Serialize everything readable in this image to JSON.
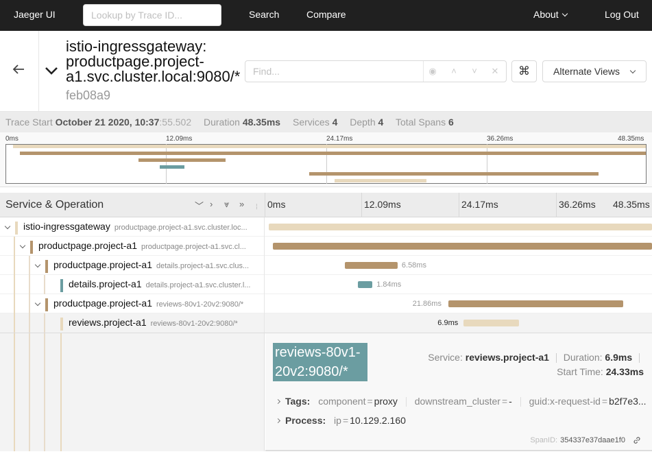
{
  "nav": {
    "brand": "Jaeger UI",
    "lookup_placeholder": "Lookup by Trace ID...",
    "search": "Search",
    "compare": "Compare",
    "about": "About",
    "logout": "Log Out"
  },
  "header": {
    "title": "istio-ingressgateway: productpage.project-a1.svc.cluster.local:9080/*",
    "trace_id": "feb08a9",
    "find_placeholder": "Find...",
    "alternate_views": "Alternate Views",
    "shortcut_glyph": "⌘"
  },
  "summary": {
    "trace_start_label": "Trace Start",
    "trace_start_value": "October 21 2020, 10:37",
    "trace_start_secs": ":55.502",
    "duration_label": "Duration",
    "duration_value": "48.35ms",
    "services_label": "Services",
    "services_value": "4",
    "depth_label": "Depth",
    "depth_value": "4",
    "total_spans_label": "Total Spans",
    "total_spans_value": "6"
  },
  "ticks": [
    "0ms",
    "12.09ms",
    "24.17ms",
    "36.26ms",
    "48.35ms"
  ],
  "table": {
    "column_title": "Service & Operation"
  },
  "colors": {
    "istio": "#e8d9bd",
    "productpage": "#b4946c",
    "details": "#6b9da1",
    "reviews": "#e8d9bd"
  },
  "spans": [
    {
      "service": "istio-ingressgateway",
      "operation": "productpage.project-a1.svc.cluster.loc...",
      "depth": 0,
      "color": "#e8d9bd",
      "start_ms": 0,
      "duration_ms": 48.35,
      "label": ""
    },
    {
      "service": "productpage.project-a1",
      "operation": "productpage.project-a1.svc.cl...",
      "depth": 1,
      "color": "#b4946c",
      "start_ms": 0.5,
      "duration_ms": 47.4,
      "label": ""
    },
    {
      "service": "productpage.project-a1",
      "operation": "details.project-a1.svc.clus...",
      "depth": 2,
      "color": "#b4946c",
      "start_ms": 9.5,
      "duration_ms": 6.58,
      "label": "6.58ms"
    },
    {
      "service": "details.project-a1",
      "operation": "details.project-a1.svc.cluster.l...",
      "depth": 3,
      "color": "#6b9da1",
      "start_ms": 11.1,
      "duration_ms": 1.84,
      "label": "1.84ms"
    },
    {
      "service": "productpage.project-a1",
      "operation": "reviews-80v1-20v2:9080/*",
      "depth": 2,
      "color": "#b4946c",
      "start_ms": 22.4,
      "duration_ms": 21.86,
      "label": "21.86ms"
    },
    {
      "service": "reviews.project-a1",
      "operation": "reviews-80v1-20v2:9080/*",
      "depth": 3,
      "color": "#e8d9bd",
      "start_ms": 24.33,
      "duration_ms": 6.9,
      "label": "6.9ms"
    }
  ],
  "detail": {
    "title": "reviews-80v1-20v2:9080/*",
    "service_label": "Service:",
    "service_value": "reviews.project-a1",
    "duration_label": "Duration:",
    "duration_value": "6.9ms",
    "start_label": "Start Time:",
    "start_value": "24.33ms",
    "tags_label": "Tags:",
    "tags": [
      {
        "key": "component",
        "value": "proxy"
      },
      {
        "key": "downstream_cluster",
        "value": "-"
      },
      {
        "key": "guid:x-request-id",
        "value": "b2f7e3..."
      }
    ],
    "process_label": "Process:",
    "process": [
      {
        "key": "ip",
        "value": "10.129.2.160"
      }
    ],
    "span_id_label": "SpanID:",
    "span_id_value": "354337e37daae1f0"
  }
}
